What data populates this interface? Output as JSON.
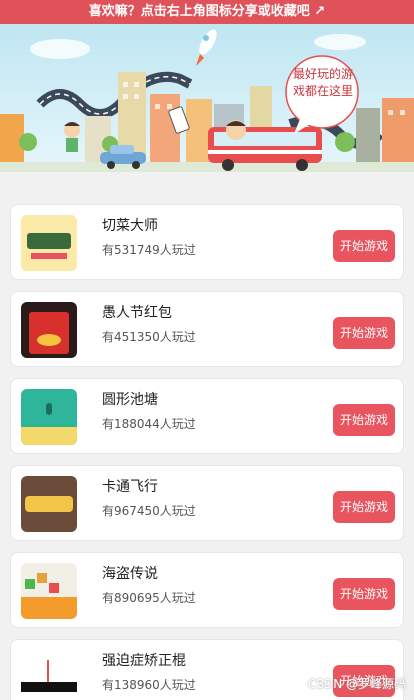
{
  "topbar": {
    "text": "喜欢嘛？点击右上角图标分享或收藏吧 ↗"
  },
  "banner": {
    "sign_text": "最好玩的游戏都在这里"
  },
  "games": [
    {
      "name": "切菜大师",
      "plays": "有531749人玩过",
      "button": "开始游戏",
      "icon": "vegetable-cutting-icon"
    },
    {
      "name": "愚人节红包",
      "plays": "有451350人玩过",
      "button": "开始游戏",
      "icon": "red-envelope-icon"
    },
    {
      "name": "圆形池塘",
      "plays": "有188044人玩过",
      "button": "开始游戏",
      "icon": "pond-icon"
    },
    {
      "name": "卡通飞行",
      "plays": "有967450人玩过",
      "button": "开始游戏",
      "icon": "cartoon-plane-icon"
    },
    {
      "name": "海盗传说",
      "plays": "有890695人玩过",
      "button": "开始游戏",
      "icon": "pirate-icon"
    },
    {
      "name": "强迫症矫正棍",
      "plays": "有138960人玩过",
      "button": "开始游戏",
      "icon": "stick-icon"
    }
  ],
  "watermark": "CSDN @罗峰源码"
}
